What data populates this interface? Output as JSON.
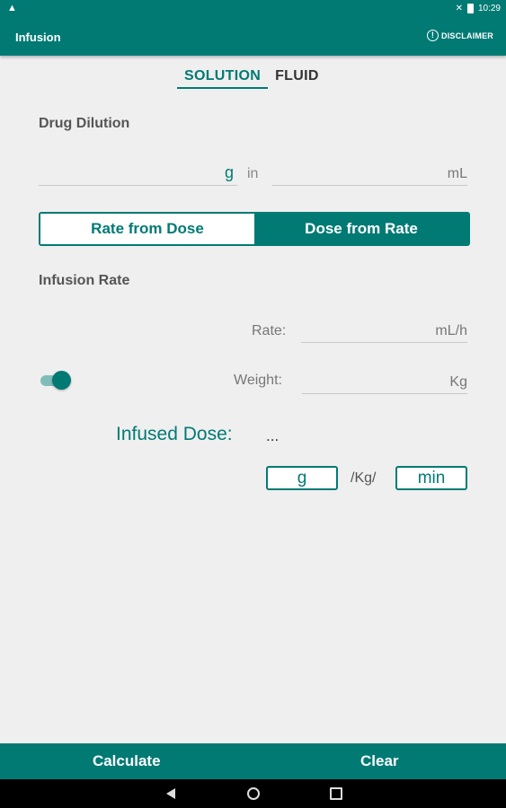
{
  "status_bar": {
    "alert_icon": "warning-icon",
    "time": "10:29"
  },
  "app_bar": {
    "title": "Infusion",
    "disclaimer_label": "DISCLAIMER",
    "disclaimer_icon": "info-icon"
  },
  "tabs": [
    {
      "label": "SOLUTION",
      "active": true
    },
    {
      "label": "FLUID",
      "active": false
    }
  ],
  "drug_dilution": {
    "heading": "Drug Dilution",
    "amount_value": "",
    "amount_unit": "g",
    "joiner": "in",
    "volume_value": "",
    "volume_unit": "mL"
  },
  "mode_toggle": {
    "options": [
      "Rate from Dose",
      "Dose from Rate"
    ],
    "selected": "Dose from Rate"
  },
  "infusion_rate": {
    "heading": "Infusion Rate",
    "rate_label": "Rate:",
    "rate_unit": "mL/h",
    "weight_label": "Weight:",
    "weight_unit": "Kg",
    "weight_switch_on": true
  },
  "result": {
    "label": "Infused Dose:",
    "value": "...",
    "mass_unit": "g",
    "per_weight": "/Kg/",
    "time_unit": "min"
  },
  "bottom_bar": {
    "calculate": "Calculate",
    "clear": "Clear"
  },
  "colors": {
    "primary": "#017a74",
    "background": "#efefef"
  }
}
